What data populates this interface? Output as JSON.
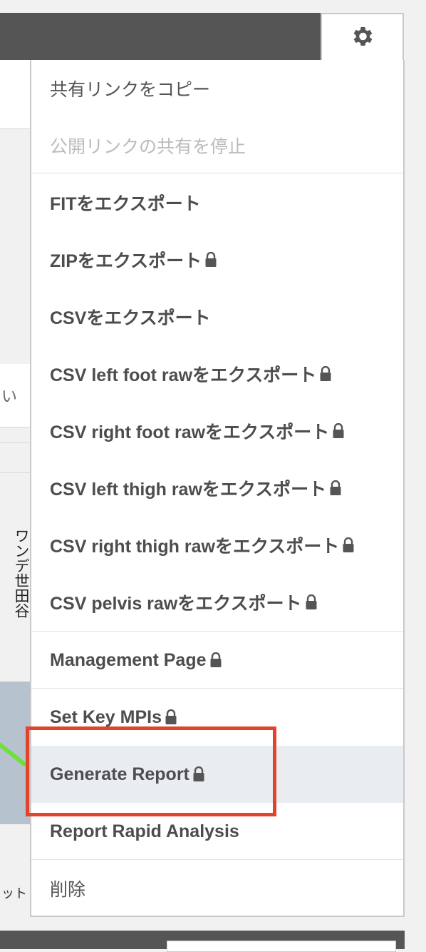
{
  "menu": {
    "items": [
      {
        "label": "共有リンクをコピー",
        "locked": false,
        "disabled": false
      },
      {
        "label": "公開リンクの共有を停止",
        "locked": false,
        "disabled": true
      },
      {
        "label": "FITをエクスポート",
        "locked": false,
        "disabled": false
      },
      {
        "label": "ZIPをエクスポート",
        "locked": true,
        "disabled": false
      },
      {
        "label": "CSVをエクスポート",
        "locked": false,
        "disabled": false
      },
      {
        "label": "CSV left foot rawをエクスポート",
        "locked": true,
        "disabled": false
      },
      {
        "label": "CSV right foot rawをエクスポート",
        "locked": true,
        "disabled": false
      },
      {
        "label": "CSV left thigh rawをエクスポート",
        "locked": true,
        "disabled": false
      },
      {
        "label": "CSV right thigh rawをエクスポート",
        "locked": true,
        "disabled": false
      },
      {
        "label": "CSV pelvis rawをエクスポート",
        "locked": true,
        "disabled": false
      },
      {
        "label": "Management Page",
        "locked": true,
        "disabled": false
      },
      {
        "label": "Set Key MPIs",
        "locked": true,
        "disabled": false
      },
      {
        "label": "Generate Report",
        "locked": true,
        "disabled": false
      },
      {
        "label": "Report Rapid Analysis",
        "locked": false,
        "disabled": false
      },
      {
        "label": "削除",
        "locked": false,
        "disabled": false
      }
    ]
  },
  "background": {
    "partial_text": "い",
    "vertical_text": "ワンデ世田谷",
    "bottom_text": "ット"
  },
  "icons": {
    "settings": "gear-icon",
    "lock": "lock-icon"
  },
  "colors": {
    "header": "#555555",
    "highlight": "#e9edf1",
    "annotation": "#e2432b"
  }
}
